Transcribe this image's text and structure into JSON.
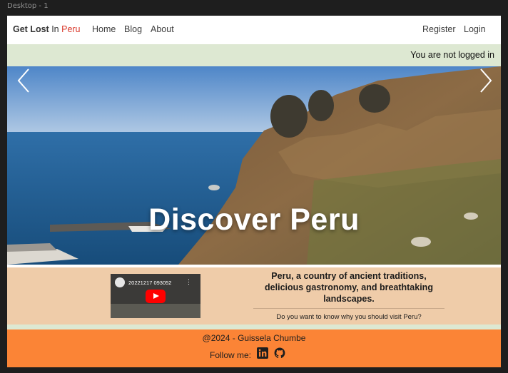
{
  "frame": {
    "label": "Desktop - 1"
  },
  "navbar": {
    "brand": {
      "part1": "Get Lost",
      "part2": "In",
      "part3": "Peru"
    },
    "links": {
      "home": "Home",
      "blog": "Blog",
      "about": "About",
      "register": "Register",
      "login": "Login"
    }
  },
  "status": {
    "text": "You are not logged in"
  },
  "hero": {
    "title": "Discover Peru",
    "prev_icon": "chevron-left-icon",
    "next_icon": "chevron-right-icon"
  },
  "info": {
    "video_title": "20221217 093052",
    "video_menu": "⋮",
    "headline_lines": [
      "Peru, a country of ancient traditions,",
      "delicious gastronomy, and breathtaking",
      "landscapes."
    ],
    "question": "Do you want to know why you should visit Peru?"
  },
  "footer": {
    "copyright": "@2024 - Guissela Chumbe",
    "follow": "Follow me:",
    "social_icons": [
      "linkedin-icon",
      "github-icon"
    ]
  },
  "colors": {
    "page_bg": "#1e1e1e",
    "brand_accent": "#d9382b",
    "status_bg": "#dde8d2",
    "info_bg": "#efcca9",
    "footer_bg": "#fb8436"
  }
}
